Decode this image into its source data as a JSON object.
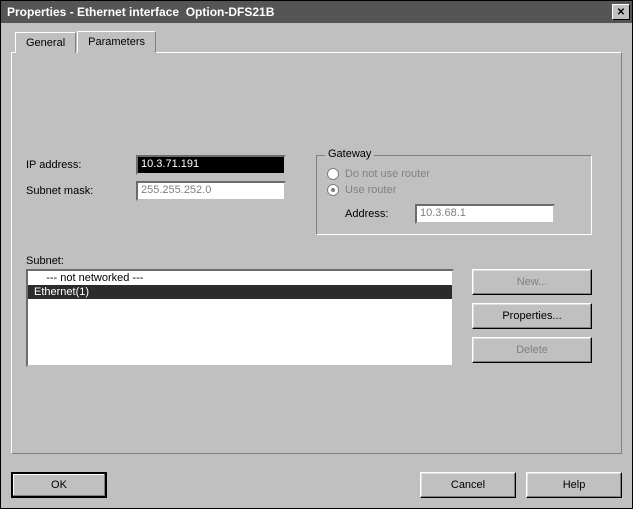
{
  "window": {
    "title": "Properties - Ethernet interface  Option-DFS21B",
    "close_label": "X"
  },
  "tabs": {
    "general": "General",
    "parameters": "Parameters",
    "active": "parameters"
  },
  "fields": {
    "ip_label": "IP address:",
    "ip_value": "10.3.71.191",
    "mask_label": "Subnet mask:",
    "mask_value": "255.255.252.0"
  },
  "gateway": {
    "legend": "Gateway",
    "no_router_label": "Do not use router",
    "use_router_label": "Use router",
    "selected": "use_router",
    "address_label": "Address:",
    "address_value": "10.3.68.1"
  },
  "subnet": {
    "label": "Subnet:",
    "items": [
      {
        "text": "    --- not networked ---",
        "selected": false,
        "is_placeholder": true
      },
      {
        "text": "Ethernet(1)",
        "selected": true,
        "is_placeholder": false
      }
    ]
  },
  "buttons": {
    "new": "New...",
    "properties": "Properties...",
    "delete": "Delete",
    "ok": "OK",
    "cancel": "Cancel",
    "help": "Help"
  }
}
